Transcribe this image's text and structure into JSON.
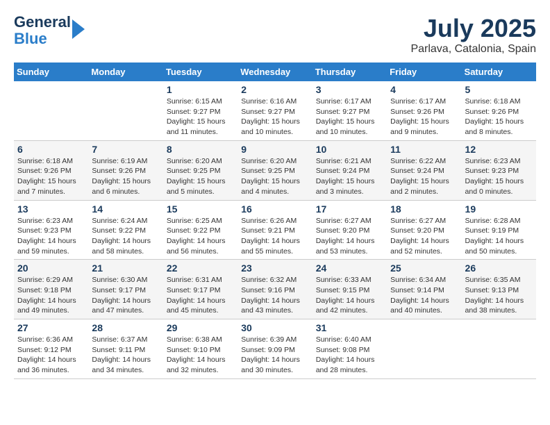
{
  "logo": {
    "line1": "General",
    "line2": "Blue"
  },
  "title": "July 2025",
  "subtitle": "Parlava, Catalonia, Spain",
  "weekdays": [
    "Sunday",
    "Monday",
    "Tuesday",
    "Wednesday",
    "Thursday",
    "Friday",
    "Saturday"
  ],
  "weeks": [
    [
      {
        "day": "",
        "info": ""
      },
      {
        "day": "",
        "info": ""
      },
      {
        "day": "1",
        "info": "Sunrise: 6:15 AM\nSunset: 9:27 PM\nDaylight: 15 hours\nand 11 minutes."
      },
      {
        "day": "2",
        "info": "Sunrise: 6:16 AM\nSunset: 9:27 PM\nDaylight: 15 hours\nand 10 minutes."
      },
      {
        "day": "3",
        "info": "Sunrise: 6:17 AM\nSunset: 9:27 PM\nDaylight: 15 hours\nand 10 minutes."
      },
      {
        "day": "4",
        "info": "Sunrise: 6:17 AM\nSunset: 9:26 PM\nDaylight: 15 hours\nand 9 minutes."
      },
      {
        "day": "5",
        "info": "Sunrise: 6:18 AM\nSunset: 9:26 PM\nDaylight: 15 hours\nand 8 minutes."
      }
    ],
    [
      {
        "day": "6",
        "info": "Sunrise: 6:18 AM\nSunset: 9:26 PM\nDaylight: 15 hours\nand 7 minutes."
      },
      {
        "day": "7",
        "info": "Sunrise: 6:19 AM\nSunset: 9:26 PM\nDaylight: 15 hours\nand 6 minutes."
      },
      {
        "day": "8",
        "info": "Sunrise: 6:20 AM\nSunset: 9:25 PM\nDaylight: 15 hours\nand 5 minutes."
      },
      {
        "day": "9",
        "info": "Sunrise: 6:20 AM\nSunset: 9:25 PM\nDaylight: 15 hours\nand 4 minutes."
      },
      {
        "day": "10",
        "info": "Sunrise: 6:21 AM\nSunset: 9:24 PM\nDaylight: 15 hours\nand 3 minutes."
      },
      {
        "day": "11",
        "info": "Sunrise: 6:22 AM\nSunset: 9:24 PM\nDaylight: 15 hours\nand 2 minutes."
      },
      {
        "day": "12",
        "info": "Sunrise: 6:23 AM\nSunset: 9:23 PM\nDaylight: 15 hours\nand 0 minutes."
      }
    ],
    [
      {
        "day": "13",
        "info": "Sunrise: 6:23 AM\nSunset: 9:23 PM\nDaylight: 14 hours\nand 59 minutes."
      },
      {
        "day": "14",
        "info": "Sunrise: 6:24 AM\nSunset: 9:22 PM\nDaylight: 14 hours\nand 58 minutes."
      },
      {
        "day": "15",
        "info": "Sunrise: 6:25 AM\nSunset: 9:22 PM\nDaylight: 14 hours\nand 56 minutes."
      },
      {
        "day": "16",
        "info": "Sunrise: 6:26 AM\nSunset: 9:21 PM\nDaylight: 14 hours\nand 55 minutes."
      },
      {
        "day": "17",
        "info": "Sunrise: 6:27 AM\nSunset: 9:20 PM\nDaylight: 14 hours\nand 53 minutes."
      },
      {
        "day": "18",
        "info": "Sunrise: 6:27 AM\nSunset: 9:20 PM\nDaylight: 14 hours\nand 52 minutes."
      },
      {
        "day": "19",
        "info": "Sunrise: 6:28 AM\nSunset: 9:19 PM\nDaylight: 14 hours\nand 50 minutes."
      }
    ],
    [
      {
        "day": "20",
        "info": "Sunrise: 6:29 AM\nSunset: 9:18 PM\nDaylight: 14 hours\nand 49 minutes."
      },
      {
        "day": "21",
        "info": "Sunrise: 6:30 AM\nSunset: 9:17 PM\nDaylight: 14 hours\nand 47 minutes."
      },
      {
        "day": "22",
        "info": "Sunrise: 6:31 AM\nSunset: 9:17 PM\nDaylight: 14 hours\nand 45 minutes."
      },
      {
        "day": "23",
        "info": "Sunrise: 6:32 AM\nSunset: 9:16 PM\nDaylight: 14 hours\nand 43 minutes."
      },
      {
        "day": "24",
        "info": "Sunrise: 6:33 AM\nSunset: 9:15 PM\nDaylight: 14 hours\nand 42 minutes."
      },
      {
        "day": "25",
        "info": "Sunrise: 6:34 AM\nSunset: 9:14 PM\nDaylight: 14 hours\nand 40 minutes."
      },
      {
        "day": "26",
        "info": "Sunrise: 6:35 AM\nSunset: 9:13 PM\nDaylight: 14 hours\nand 38 minutes."
      }
    ],
    [
      {
        "day": "27",
        "info": "Sunrise: 6:36 AM\nSunset: 9:12 PM\nDaylight: 14 hours\nand 36 minutes."
      },
      {
        "day": "28",
        "info": "Sunrise: 6:37 AM\nSunset: 9:11 PM\nDaylight: 14 hours\nand 34 minutes."
      },
      {
        "day": "29",
        "info": "Sunrise: 6:38 AM\nSunset: 9:10 PM\nDaylight: 14 hours\nand 32 minutes."
      },
      {
        "day": "30",
        "info": "Sunrise: 6:39 AM\nSunset: 9:09 PM\nDaylight: 14 hours\nand 30 minutes."
      },
      {
        "day": "31",
        "info": "Sunrise: 6:40 AM\nSunset: 9:08 PM\nDaylight: 14 hours\nand 28 minutes."
      },
      {
        "day": "",
        "info": ""
      },
      {
        "day": "",
        "info": ""
      }
    ]
  ]
}
